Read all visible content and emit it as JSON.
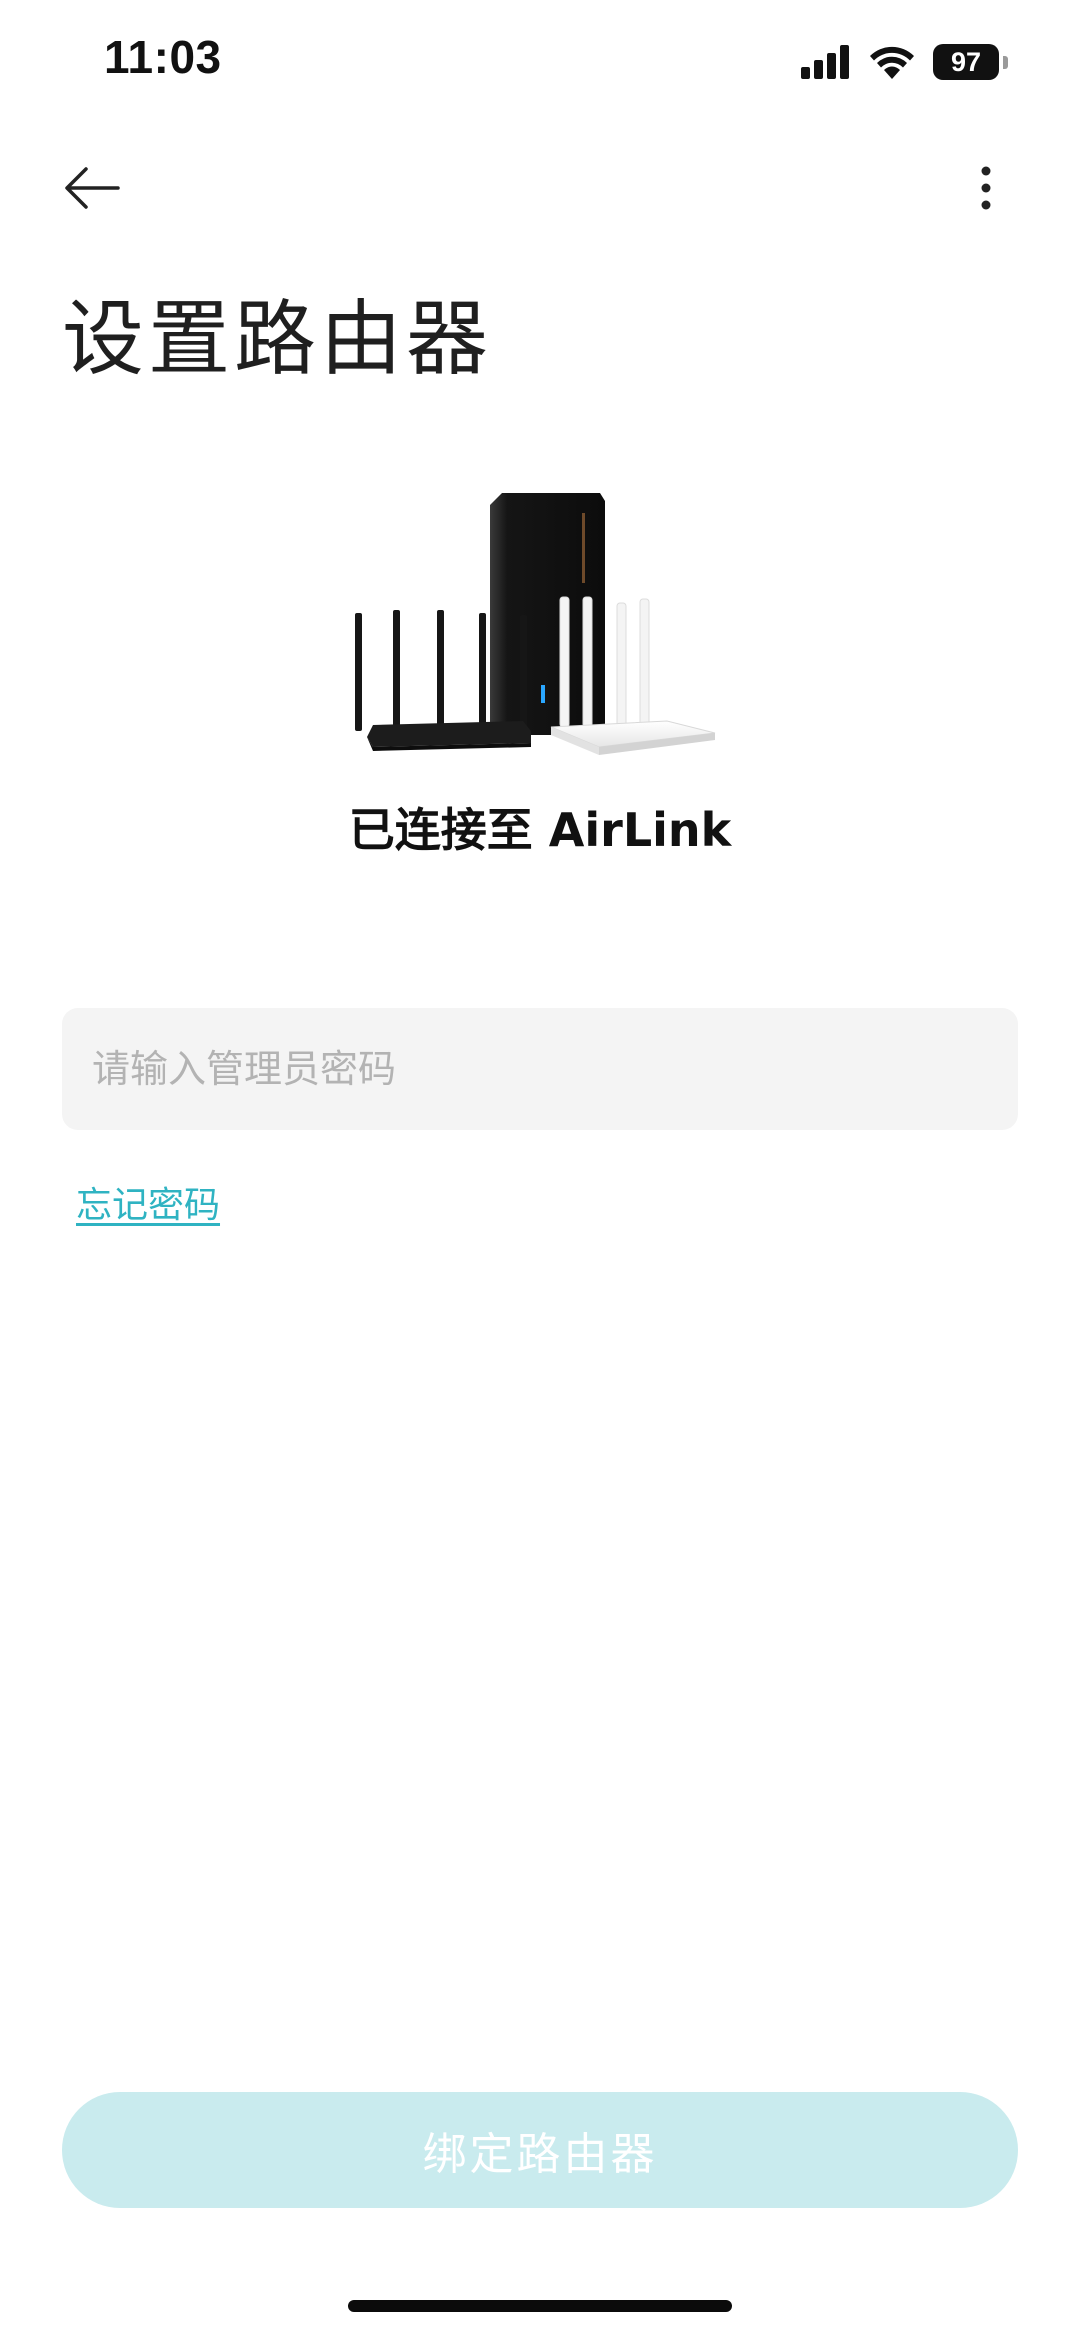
{
  "status_bar": {
    "time": "11:03",
    "battery_level": "97",
    "icons": [
      "cellular-signal-icon",
      "wifi-icon",
      "battery-icon"
    ]
  },
  "nav": {
    "back_icon": "arrow-left-icon",
    "more_icon": "more-vertical-icon"
  },
  "page": {
    "title": "设置路由器",
    "connected_text": "已连接至 AirLink",
    "illustration": "router-family-image"
  },
  "form": {
    "password_value": "",
    "password_placeholder": "请输入管理员密码",
    "forgot_password_label": "忘记密码"
  },
  "actions": {
    "bind_label": "绑定路由器",
    "bind_enabled": false
  },
  "colors": {
    "accent": "#2fb3c2",
    "button_disabled_bg": "#c9ebee",
    "input_bg": "#f4f4f4",
    "text_primary": "#1f1f1f",
    "placeholder": "#b3b3b3"
  }
}
